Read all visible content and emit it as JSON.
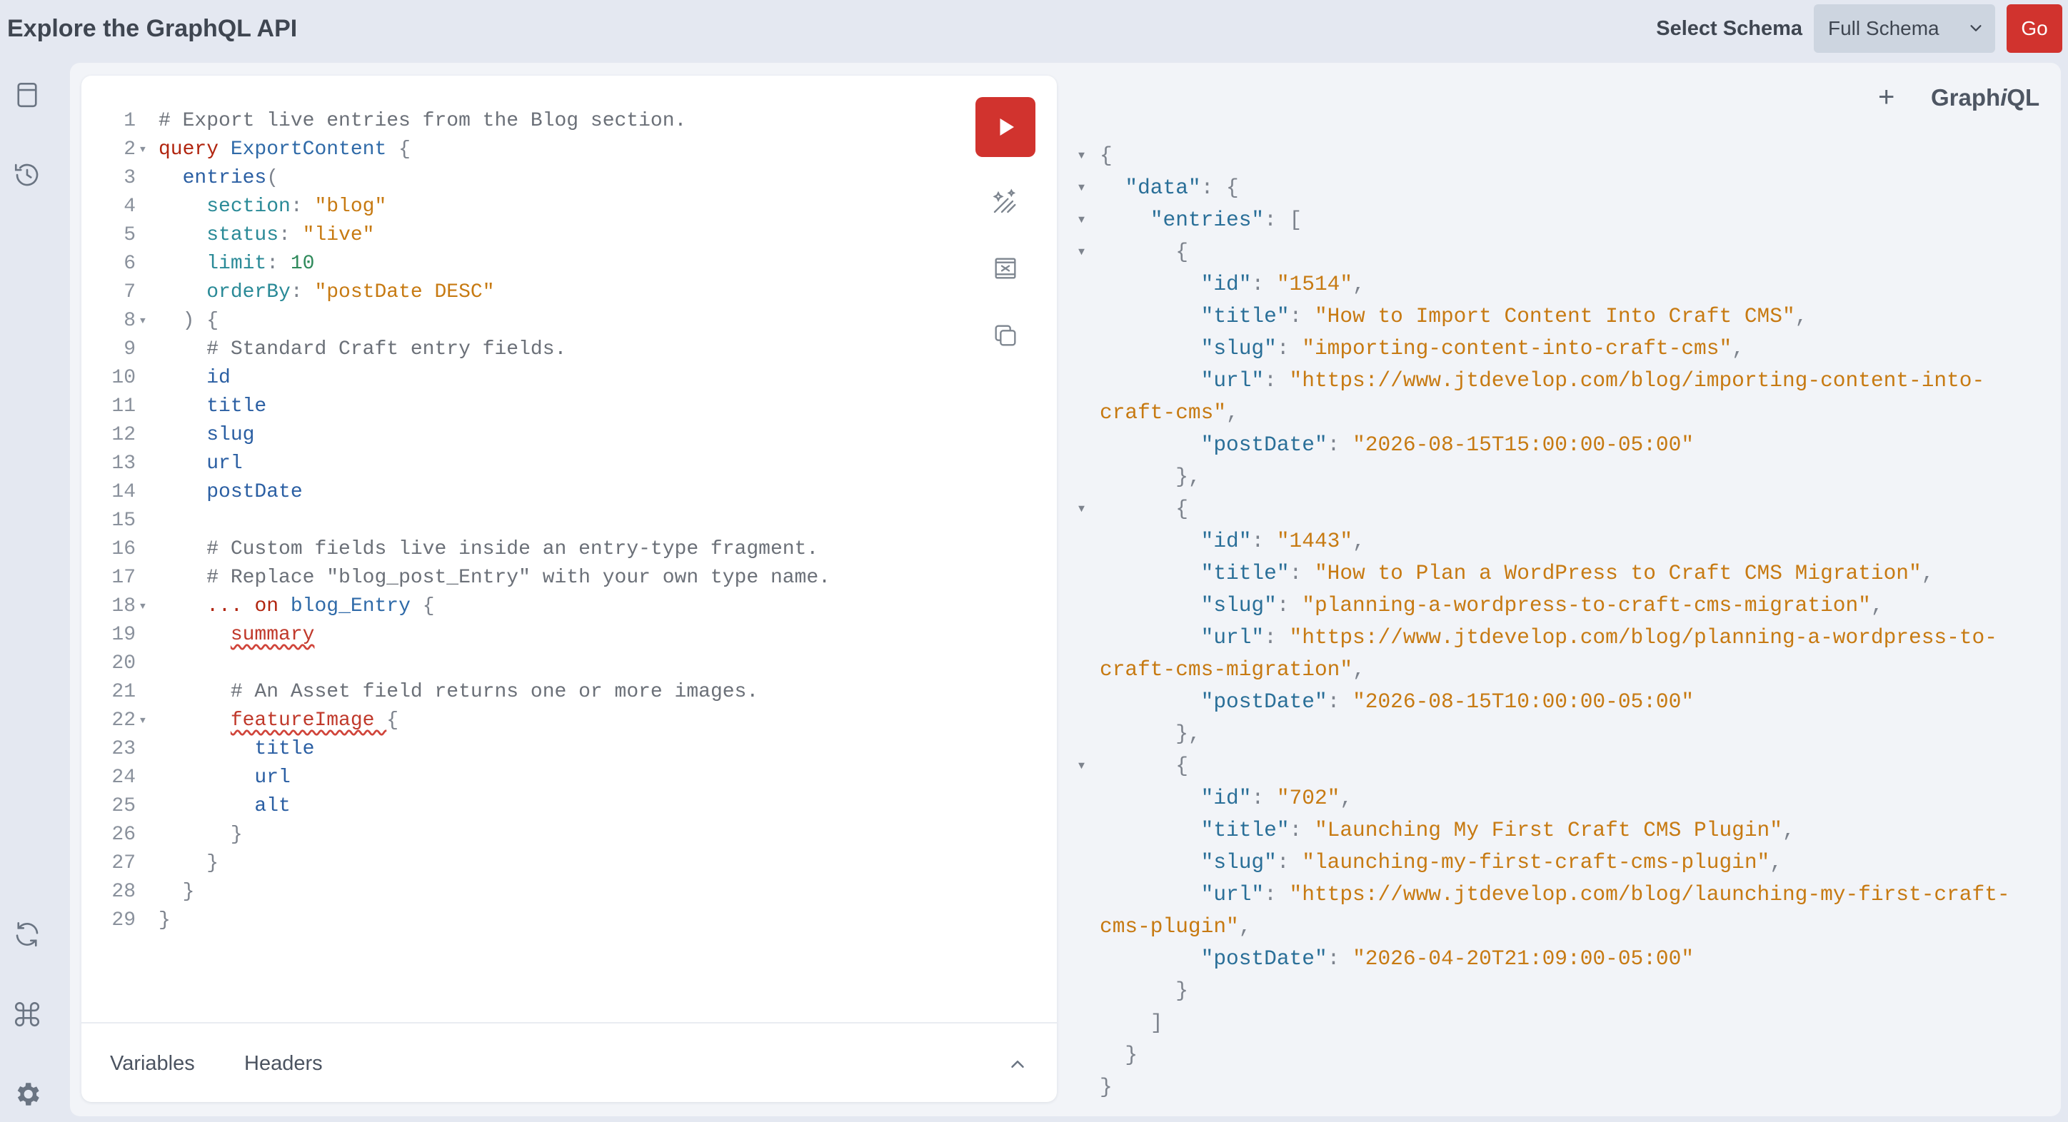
{
  "header": {
    "title": "Explore the GraphQL API",
    "schema_label": "Select Schema",
    "schema_selected": "Full Schema",
    "go_label": "Go"
  },
  "sidebar": {
    "icons": [
      "docs-icon",
      "history-icon",
      "refetch-schema-icon",
      "shortcuts-icon",
      "settings-icon"
    ]
  },
  "editor": {
    "lines": [
      [
        [
          "c",
          "# Export live entries from the Blog section."
        ]
      ],
      [
        [
          "k",
          "query"
        ],
        [
          "t",
          " "
        ],
        [
          "n",
          "ExportContent"
        ],
        [
          "p",
          " {"
        ]
      ],
      [
        [
          "t",
          "  "
        ],
        [
          "f",
          "entries"
        ],
        [
          "p",
          "("
        ]
      ],
      [
        [
          "t",
          "    "
        ],
        [
          "a",
          "section"
        ],
        [
          "p",
          ": "
        ],
        [
          "s",
          "\"blog\""
        ]
      ],
      [
        [
          "t",
          "    "
        ],
        [
          "a",
          "status"
        ],
        [
          "p",
          ": "
        ],
        [
          "s",
          "\"live\""
        ]
      ],
      [
        [
          "t",
          "    "
        ],
        [
          "a",
          "limit"
        ],
        [
          "p",
          ": "
        ],
        [
          "num",
          "10"
        ]
      ],
      [
        [
          "t",
          "    "
        ],
        [
          "a",
          "orderBy"
        ],
        [
          "p",
          ": "
        ],
        [
          "s",
          "\"postDate DESC\""
        ]
      ],
      [
        [
          "p",
          "  ) {"
        ]
      ],
      [
        [
          "t",
          "    "
        ],
        [
          "c",
          "# Standard Craft entry fields."
        ]
      ],
      [
        [
          "t",
          "    "
        ],
        [
          "f",
          "id"
        ]
      ],
      [
        [
          "t",
          "    "
        ],
        [
          "f",
          "title"
        ]
      ],
      [
        [
          "t",
          "    "
        ],
        [
          "f",
          "slug"
        ]
      ],
      [
        [
          "t",
          "    "
        ],
        [
          "f",
          "url"
        ]
      ],
      [
        [
          "t",
          "    "
        ],
        [
          "f",
          "postDate"
        ]
      ],
      [],
      [
        [
          "t",
          "    "
        ],
        [
          "c",
          "# Custom fields live inside an entry-type fragment."
        ]
      ],
      [
        [
          "t",
          "    "
        ],
        [
          "c",
          "# Replace \"blog_post_Entry\" with your own type name."
        ]
      ],
      [
        [
          "t",
          "    "
        ],
        [
          "k",
          "..."
        ],
        [
          "t",
          " "
        ],
        [
          "k",
          "on"
        ],
        [
          "t",
          " "
        ],
        [
          "n",
          "blog_Entry"
        ],
        [
          "p",
          " {"
        ]
      ],
      [
        [
          "t",
          "      "
        ],
        [
          "e",
          "summary"
        ]
      ],
      [],
      [
        [
          "t",
          "      "
        ],
        [
          "c",
          "# An Asset field returns one or more images."
        ]
      ],
      [
        [
          "t",
          "      "
        ],
        [
          "e",
          "featureImage "
        ],
        [
          "p",
          "{"
        ]
      ],
      [
        [
          "t",
          "        "
        ],
        [
          "f",
          "title"
        ]
      ],
      [
        [
          "t",
          "        "
        ],
        [
          "f",
          "url"
        ]
      ],
      [
        [
          "t",
          "        "
        ],
        [
          "f",
          "alt"
        ]
      ],
      [
        [
          "p",
          "      }"
        ]
      ],
      [
        [
          "p",
          "    }"
        ]
      ],
      [
        [
          "p",
          "  }"
        ]
      ],
      [
        [
          "p",
          "}"
        ]
      ]
    ],
    "folds": [
      2,
      8,
      18,
      22
    ],
    "tabs": {
      "variables": "Variables",
      "headers": "Headers"
    }
  },
  "results": {
    "brand_prefix": "Graph",
    "brand_italic": "i",
    "brand_suffix": "QL",
    "add_tab": "+",
    "lines": [
      {
        "fold": true,
        "indent": 0,
        "tokens": [
          [
            "p",
            "{"
          ]
        ]
      },
      {
        "fold": true,
        "indent": 2,
        "tokens": [
          [
            "k",
            "\"data\""
          ],
          [
            "p",
            ": {"
          ]
        ]
      },
      {
        "fold": true,
        "indent": 4,
        "tokens": [
          [
            "k",
            "\"entries\""
          ],
          [
            "p",
            ": ["
          ]
        ]
      },
      {
        "fold": true,
        "indent": 6,
        "tokens": [
          [
            "p",
            "{"
          ]
        ]
      },
      {
        "fold": false,
        "indent": 8,
        "tokens": [
          [
            "k",
            "\"id\""
          ],
          [
            "p",
            ": "
          ],
          [
            "s",
            "\"1514\""
          ],
          [
            "p",
            ","
          ]
        ]
      },
      {
        "fold": false,
        "indent": 8,
        "tokens": [
          [
            "k",
            "\"title\""
          ],
          [
            "p",
            ": "
          ],
          [
            "s",
            "\"How to Import Content Into Craft CMS\""
          ],
          [
            "p",
            ","
          ]
        ]
      },
      {
        "fold": false,
        "indent": 8,
        "tokens": [
          [
            "k",
            "\"slug\""
          ],
          [
            "p",
            ": "
          ],
          [
            "s",
            "\"importing-content-into-craft-cms\""
          ],
          [
            "p",
            ","
          ]
        ]
      },
      {
        "fold": false,
        "indent": 8,
        "tokens": [
          [
            "k",
            "\"url\""
          ],
          [
            "p",
            ": "
          ],
          [
            "s",
            "\"https://www.jtdevelop.com/blog/importing-content-into-"
          ]
        ]
      },
      {
        "fold": false,
        "indent": 0,
        "tokens": [
          [
            "s",
            "craft-cms\""
          ],
          [
            "p",
            ","
          ]
        ]
      },
      {
        "fold": false,
        "indent": 8,
        "tokens": [
          [
            "k",
            "\"postDate\""
          ],
          [
            "p",
            ": "
          ],
          [
            "s",
            "\"2026-08-15T15:00:00-05:00\""
          ]
        ]
      },
      {
        "fold": false,
        "indent": 6,
        "tokens": [
          [
            "p",
            "},"
          ]
        ]
      },
      {
        "fold": true,
        "indent": 6,
        "tokens": [
          [
            "p",
            "{"
          ]
        ]
      },
      {
        "fold": false,
        "indent": 8,
        "tokens": [
          [
            "k",
            "\"id\""
          ],
          [
            "p",
            ": "
          ],
          [
            "s",
            "\"1443\""
          ],
          [
            "p",
            ","
          ]
        ]
      },
      {
        "fold": false,
        "indent": 8,
        "tokens": [
          [
            "k",
            "\"title\""
          ],
          [
            "p",
            ": "
          ],
          [
            "s",
            "\"How to Plan a WordPress to Craft CMS Migration\""
          ],
          [
            "p",
            ","
          ]
        ]
      },
      {
        "fold": false,
        "indent": 8,
        "tokens": [
          [
            "k",
            "\"slug\""
          ],
          [
            "p",
            ": "
          ],
          [
            "s",
            "\"planning-a-wordpress-to-craft-cms-migration\""
          ],
          [
            "p",
            ","
          ]
        ]
      },
      {
        "fold": false,
        "indent": 8,
        "tokens": [
          [
            "k",
            "\"url\""
          ],
          [
            "p",
            ": "
          ],
          [
            "s",
            "\"https://www.jtdevelop.com/blog/planning-a-wordpress-to-"
          ]
        ]
      },
      {
        "fold": false,
        "indent": 0,
        "tokens": [
          [
            "s",
            "craft-cms-migration\""
          ],
          [
            "p",
            ","
          ]
        ]
      },
      {
        "fold": false,
        "indent": 8,
        "tokens": [
          [
            "k",
            "\"postDate\""
          ],
          [
            "p",
            ": "
          ],
          [
            "s",
            "\"2026-08-15T10:00:00-05:00\""
          ]
        ]
      },
      {
        "fold": false,
        "indent": 6,
        "tokens": [
          [
            "p",
            "},"
          ]
        ]
      },
      {
        "fold": true,
        "indent": 6,
        "tokens": [
          [
            "p",
            "{"
          ]
        ]
      },
      {
        "fold": false,
        "indent": 8,
        "tokens": [
          [
            "k",
            "\"id\""
          ],
          [
            "p",
            ": "
          ],
          [
            "s",
            "\"702\""
          ],
          [
            "p",
            ","
          ]
        ]
      },
      {
        "fold": false,
        "indent": 8,
        "tokens": [
          [
            "k",
            "\"title\""
          ],
          [
            "p",
            ": "
          ],
          [
            "s",
            "\"Launching My First Craft CMS Plugin\""
          ],
          [
            "p",
            ","
          ]
        ]
      },
      {
        "fold": false,
        "indent": 8,
        "tokens": [
          [
            "k",
            "\"slug\""
          ],
          [
            "p",
            ": "
          ],
          [
            "s",
            "\"launching-my-first-craft-cms-plugin\""
          ],
          [
            "p",
            ","
          ]
        ]
      },
      {
        "fold": false,
        "indent": 8,
        "tokens": [
          [
            "k",
            "\"url\""
          ],
          [
            "p",
            ": "
          ],
          [
            "s",
            "\"https://www.jtdevelop.com/blog/launching-my-first-craft-"
          ]
        ]
      },
      {
        "fold": false,
        "indent": 0,
        "tokens": [
          [
            "s",
            "cms-plugin\""
          ],
          [
            "p",
            ","
          ]
        ]
      },
      {
        "fold": false,
        "indent": 8,
        "tokens": [
          [
            "k",
            "\"postDate\""
          ],
          [
            "p",
            ": "
          ],
          [
            "s",
            "\"2026-04-20T21:09:00-05:00\""
          ]
        ]
      },
      {
        "fold": false,
        "indent": 6,
        "tokens": [
          [
            "p",
            "}"
          ]
        ]
      },
      {
        "fold": false,
        "indent": 4,
        "tokens": [
          [
            "p",
            "]"
          ]
        ]
      },
      {
        "fold": false,
        "indent": 2,
        "tokens": [
          [
            "p",
            "}"
          ]
        ]
      },
      {
        "fold": false,
        "indent": 0,
        "tokens": [
          [
            "p",
            "}"
          ]
        ]
      }
    ]
  },
  "colors": {
    "accent": "#d1332e",
    "background": "#e4e8f1",
    "panel": "#f2f4f8"
  }
}
